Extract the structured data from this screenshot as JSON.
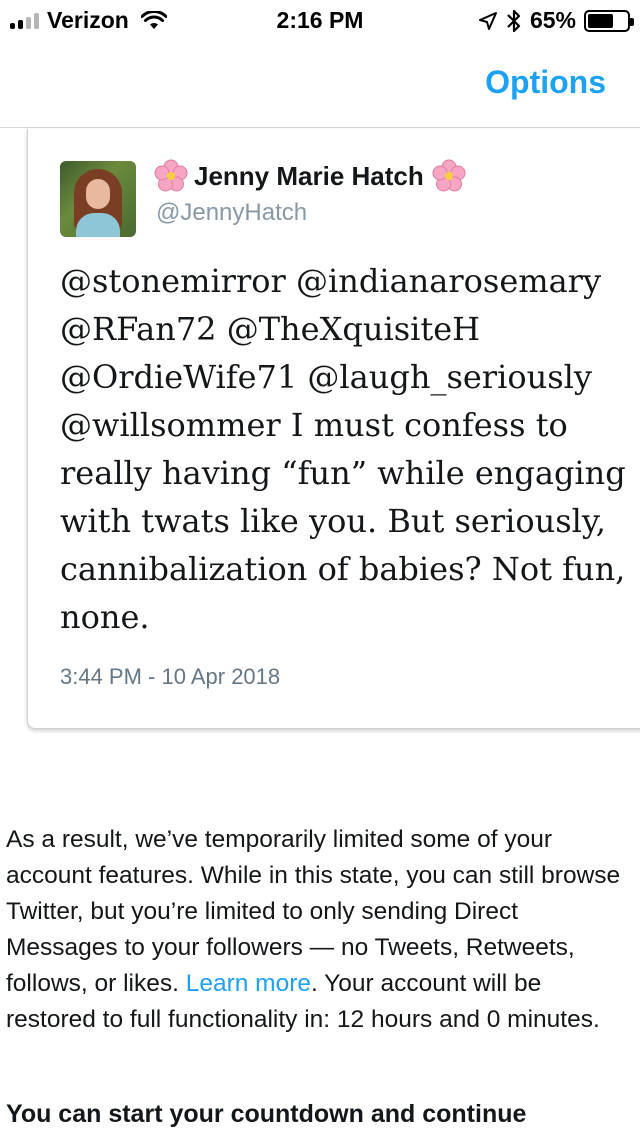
{
  "status_bar": {
    "carrier": "Verizon",
    "time": "2:16 PM",
    "battery_percent": "65%",
    "battery_level": 0.65,
    "signal_bars_filled": 2,
    "signal_bars_total": 4
  },
  "nav": {
    "options_label": "Options"
  },
  "tweet": {
    "display_name": "Jenny Marie Hatch",
    "handle": "@JennyHatch",
    "text_lines": [
      "@stonemirror @indianarosemary",
      "@RFan72 @TheXquisiteH",
      "@OrdieWife71 @laugh_seriously",
      "@willsommer I must confess to",
      "really having “fun” while engaging",
      "with twats like you. But seriously,",
      "cannibalization of babies? Not fun,",
      "none."
    ],
    "timestamp": "3:44 PM - 10 Apr 2018"
  },
  "notice": {
    "text_before_link": "As a result, we’ve temporarily limited some of your account features. While in this state, you can still browse Twitter, but you’re limited to only sending Direct Messages to your followers — no Tweets, Retweets, follows, or likes. ",
    "link_label": "Learn more",
    "text_after_link": ". Your account will be restored to full functionality in: 12 hours and 0 minutes."
  },
  "countdown_heading": "You can start your countdown and continue",
  "colors": {
    "accent": "#1da1f2",
    "muted": "#657786"
  },
  "icons": {
    "wifi": "wifi-icon",
    "location": "location-arrow-icon",
    "bluetooth": "bluetooth-icon",
    "flower": "cherry-blossom-emoji"
  }
}
